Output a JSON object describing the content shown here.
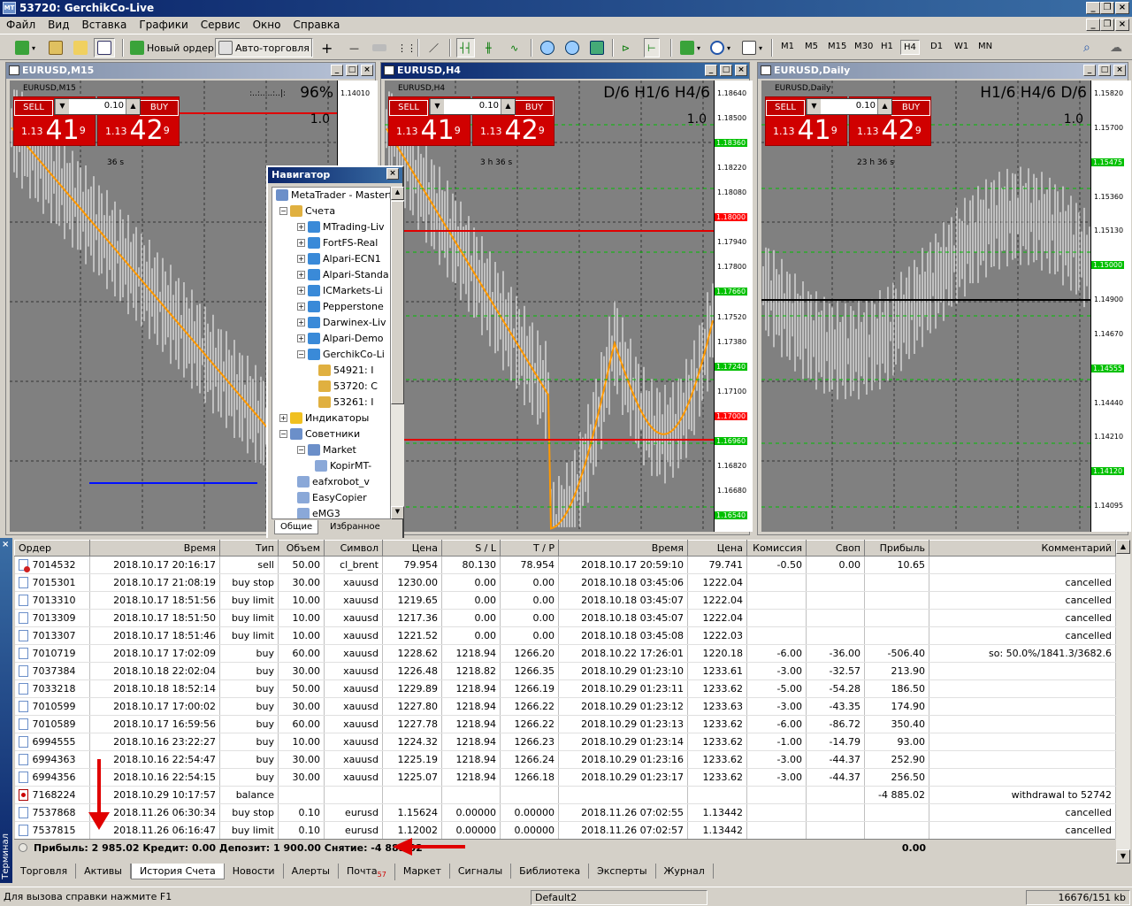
{
  "window": {
    "title": "53720: GerchikCo-Live",
    "icon_text": "MT"
  },
  "menu": [
    "Файл",
    "Вид",
    "Вставка",
    "Графики",
    "Сервис",
    "Окно",
    "Справка"
  ],
  "toolbar": {
    "new_order": "Новый ордер",
    "auto_trading": "Авто-торговля",
    "timeframes": [
      "M1",
      "M5",
      "M15",
      "M30",
      "H1",
      "H4",
      "D1",
      "W1",
      "MN"
    ],
    "active_timeframe": "H4"
  },
  "charts": [
    {
      "caption": "EURUSD,M15",
      "symbol": "EURUSD,M15",
      "ratio": "96%",
      "ratio_prefix": ":..:.....:..|:",
      "one": "1.0",
      "timer": "36 s",
      "sell_label": "SELL",
      "buy_label": "BUY",
      "lot": "0.10",
      "sell_prefix": "1.13",
      "sell_big": "41",
      "sell_sup": "9",
      "buy_prefix": "1.13",
      "buy_big": "42",
      "buy_sup": "9",
      "ticks": [
        "1.14010",
        "1.14000",
        "1.13975",
        "1.13950"
      ]
    },
    {
      "caption": "EURUSD,H4",
      "symbol": "EURUSD,H4",
      "ratio": "D/6 H1/6 H4/6",
      "one": "1.0",
      "timer": "3 h 36 s",
      "sell_label": "SELL",
      "buy_label": "BUY",
      "lot": "0.10",
      "sell_prefix": "1.13",
      "sell_big": "41",
      "sell_sup": "9",
      "buy_prefix": "1.13",
      "buy_big": "42",
      "buy_sup": "9",
      "ticks": [
        "1.18640",
        "1.18500",
        "1.18360",
        "1.18220",
        "1.18080",
        "1.18000",
        "1.17940",
        "1.17800",
        "1.17660",
        "1.17520",
        "1.17380",
        "1.17240",
        "1.17100",
        "1.17000",
        "1.16960",
        "1.16820",
        "1.16680",
        "1.16540"
      ]
    },
    {
      "caption": "EURUSD,Daily",
      "symbol": "EURUSD,Daily",
      "ratio": "H1/6 H4/6 D/6",
      "one": "1.0",
      "timer": "23 h 36 s",
      "sell_label": "SELL",
      "buy_label": "BUY",
      "lot": "0.10",
      "sell_prefix": "1.13",
      "sell_big": "41",
      "sell_sup": "9",
      "buy_prefix": "1.13",
      "buy_big": "42",
      "buy_sup": "9",
      "ticks": [
        "1.15820",
        "1.15700",
        "1.15475",
        "1.15360",
        "1.15130",
        "1.15000",
        "1.14900",
        "1.14670",
        "1.14555",
        "1.14440",
        "1.14210",
        "1.14120",
        "1.14095"
      ]
    }
  ],
  "navigator": {
    "title": "Навигатор",
    "root": "MetaTrader - Masterf",
    "accounts": "Счета",
    "servers": [
      "MTrading-Liv",
      "FortFS-Real",
      "Alpari-ECN1",
      "Alpari-Standa",
      "ICMarkets-Li",
      "Pepperstone",
      "Darwinex-Liv",
      "Alpari-Demo",
      "GerchikCo-Li"
    ],
    "logins": [
      "54921: I",
      "53720: C",
      "53261: I"
    ],
    "indicators": "Индикаторы",
    "advisors": "Советники",
    "market": "Market",
    "experts": [
      "KopirMT-",
      "eafxrobot_v",
      "EasyCopier",
      "eMG3"
    ],
    "tabs": [
      "Общие",
      "Избранное"
    ]
  },
  "terminal": {
    "side_label": "Терминал",
    "columns": [
      "Ордер",
      "Время",
      "Тип",
      "Объем",
      "Символ",
      "Цена",
      "S / L",
      "T / P",
      "Время",
      "Цена",
      "Комиссия",
      "Своп",
      "Прибыль",
      "Комментарий"
    ],
    "rows": [
      {
        "icon": "sell",
        "c": [
          "7014532",
          "2018.10.17 20:16:17",
          "sell",
          "50.00",
          "cl_brent",
          "79.954",
          "80.130",
          "78.954",
          "2018.10.17 20:59:10",
          "79.741",
          "-0.50",
          "0.00",
          "10.65",
          ""
        ]
      },
      {
        "icon": "order",
        "c": [
          "7015301",
          "2018.10.17 21:08:19",
          "buy stop",
          "30.00",
          "xauusd",
          "1230.00",
          "0.00",
          "0.00",
          "2018.10.18 03:45:06",
          "1222.04",
          "",
          "",
          "",
          "cancelled"
        ]
      },
      {
        "icon": "order",
        "c": [
          "7013310",
          "2018.10.17 18:51:56",
          "buy limit",
          "10.00",
          "xauusd",
          "1219.65",
          "0.00",
          "0.00",
          "2018.10.18 03:45:07",
          "1222.04",
          "",
          "",
          "",
          "cancelled"
        ]
      },
      {
        "icon": "order",
        "c": [
          "7013309",
          "2018.10.17 18:51:50",
          "buy limit",
          "10.00",
          "xauusd",
          "1217.36",
          "0.00",
          "0.00",
          "2018.10.18 03:45:07",
          "1222.04",
          "",
          "",
          "",
          "cancelled"
        ]
      },
      {
        "icon": "order",
        "c": [
          "7013307",
          "2018.10.17 18:51:46",
          "buy limit",
          "10.00",
          "xauusd",
          "1221.52",
          "0.00",
          "0.00",
          "2018.10.18 03:45:08",
          "1222.03",
          "",
          "",
          "",
          "cancelled"
        ]
      },
      {
        "icon": "order",
        "c": [
          "7010719",
          "2018.10.17 17:02:09",
          "buy",
          "60.00",
          "xauusd",
          "1228.62",
          "1218.94",
          "1266.20",
          "2018.10.22 17:26:01",
          "1220.18",
          "-6.00",
          "-36.00",
          "-506.40",
          "so: 50.0%/1841.3/3682.6"
        ]
      },
      {
        "icon": "order",
        "c": [
          "7037384",
          "2018.10.18 22:02:04",
          "buy",
          "30.00",
          "xauusd",
          "1226.48",
          "1218.82",
          "1266.35",
          "2018.10.29 01:23:10",
          "1233.61",
          "-3.00",
          "-32.57",
          "213.90",
          ""
        ]
      },
      {
        "icon": "order",
        "c": [
          "7033218",
          "2018.10.18 18:52:14",
          "buy",
          "50.00",
          "xauusd",
          "1229.89",
          "1218.94",
          "1266.19",
          "2018.10.29 01:23:11",
          "1233.62",
          "-5.00",
          "-54.28",
          "186.50",
          ""
        ]
      },
      {
        "icon": "order",
        "c": [
          "7010599",
          "2018.10.17 17:00:02",
          "buy",
          "30.00",
          "xauusd",
          "1227.80",
          "1218.94",
          "1266.22",
          "2018.10.29 01:23:12",
          "1233.63",
          "-3.00",
          "-43.35",
          "174.90",
          ""
        ]
      },
      {
        "icon": "order",
        "c": [
          "7010589",
          "2018.10.17 16:59:56",
          "buy",
          "60.00",
          "xauusd",
          "1227.78",
          "1218.94",
          "1266.22",
          "2018.10.29 01:23:13",
          "1233.62",
          "-6.00",
          "-86.72",
          "350.40",
          ""
        ]
      },
      {
        "icon": "order",
        "c": [
          "6994555",
          "2018.10.16 23:22:27",
          "buy",
          "10.00",
          "xauusd",
          "1224.32",
          "1218.94",
          "1266.23",
          "2018.10.29 01:23:14",
          "1233.62",
          "-1.00",
          "-14.79",
          "93.00",
          ""
        ]
      },
      {
        "icon": "order",
        "c": [
          "6994363",
          "2018.10.16 22:54:47",
          "buy",
          "30.00",
          "xauusd",
          "1225.19",
          "1218.94",
          "1266.24",
          "2018.10.29 01:23:16",
          "1233.62",
          "-3.00",
          "-44.37",
          "252.90",
          ""
        ]
      },
      {
        "icon": "order",
        "c": [
          "6994356",
          "2018.10.16 22:54:15",
          "buy",
          "30.00",
          "xauusd",
          "1225.07",
          "1218.94",
          "1266.18",
          "2018.10.29 01:23:17",
          "1233.62",
          "-3.00",
          "-44.37",
          "256.50",
          ""
        ]
      },
      {
        "icon": "balance",
        "c": [
          "7168224",
          "2018.10.29 10:17:57",
          "balance",
          "",
          "",
          "",
          "",
          "",
          "",
          "",
          "",
          "",
          "-4 885.02",
          "withdrawal to 52742"
        ]
      },
      {
        "icon": "order",
        "c": [
          "7537868",
          "2018.11.26 06:30:34",
          "buy stop",
          "0.10",
          "eurusd",
          "1.15624",
          "0.00000",
          "0.00000",
          "2018.11.26 07:02:55",
          "1.13442",
          "",
          "",
          "",
          "cancelled"
        ]
      },
      {
        "icon": "order",
        "c": [
          "7537815",
          "2018.11.26 06:16:47",
          "buy limit",
          "0.10",
          "eurusd",
          "1.12002",
          "0.00000",
          "0.00000",
          "2018.11.26 07:02:57",
          "1.13442",
          "",
          "",
          "",
          "cancelled"
        ]
      }
    ],
    "summary": "Прибыль: 2 985.02  Кредит: 0.00  Депозит: 1 900.00  Снятие: -4 885.02",
    "summary_total": "0.00",
    "tabs": [
      "Торговля",
      "Активы",
      "История Счета",
      "Новости",
      "Алерты",
      "Почта",
      "Маркет",
      "Сигналы",
      "Библиотека",
      "Эксперты",
      "Журнал"
    ],
    "mail_count": "57",
    "active_tab": "История Счета"
  },
  "status": {
    "help": "Для вызова справки нажмите F1",
    "profile": "Default2",
    "traffic": "16676/151 kb"
  },
  "colors": {
    "accent": "#0a246a",
    "sell": "#d00000",
    "plot_bg": "#808080",
    "grid_green": "#00c000",
    "ma_orange": "#ff9900"
  }
}
